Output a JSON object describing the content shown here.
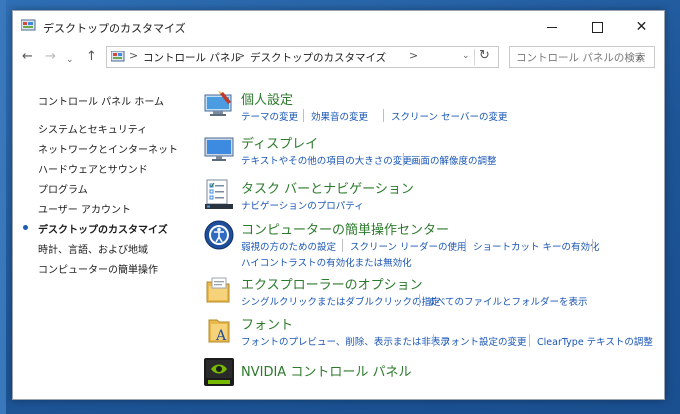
{
  "window": {
    "title": "デスクトップのカスタマイズ",
    "controls": {
      "minimize": "",
      "maximize": "",
      "close": "✕"
    }
  },
  "nav": {
    "back": "←",
    "forward": "→",
    "recent": "⌄",
    "up": "↑",
    "breadcrumbs": [
      "コントロール パネル",
      "デスクトップのカスタマイズ"
    ],
    "crumb_separator": ">",
    "refresh": "↻",
    "dropdown": "⌄"
  },
  "search": {
    "placeholder": "コントロール パネルの検索",
    "icon": "⌕"
  },
  "sidebar": {
    "home": "コントロール パネル ホーム",
    "items": [
      "システムとセキュリティ",
      "ネットワークとインターネット",
      "ハードウェアとサウンド",
      "プログラム",
      "ユーザー アカウント",
      "デスクトップのカスタマイズ",
      "時計、言語、および地域",
      "コンピューターの簡単操作"
    ],
    "current_index": 5
  },
  "categories": [
    {
      "title": "個人設定",
      "icon": "personalization-icon",
      "links": [
        "テーマの変更",
        "効果音の変更",
        "スクリーン セーバーの変更"
      ]
    },
    {
      "title": "ディスプレイ",
      "icon": "display-icon",
      "links": [
        "テキストやその他の項目の大きさの変更",
        "画面の解像度の調整"
      ]
    },
    {
      "title": "タスク バーとナビゲーション",
      "icon": "taskbar-icon",
      "links": [
        "ナビゲーションのプロパティ"
      ]
    },
    {
      "title": "コンピューターの簡単操作センター",
      "icon": "ease-of-access-icon",
      "links": [
        "弱視の方のための設定",
        "スクリーン リーダーの使用",
        "ショートカット キーの有効化"
      ],
      "links2": [
        "ハイコントラストの有効化または無効化"
      ]
    },
    {
      "title": "エクスプローラーのオプション",
      "icon": "folder-options-icon",
      "links": [
        "シングルクリックまたはダブルクリックの指定",
        "すべてのファイルとフォルダーを表示"
      ]
    },
    {
      "title": "フォント",
      "icon": "fonts-icon",
      "links": [
        "フォントのプレビュー、削除、表示または非表示",
        "フォント設定の変更",
        "ClearType テキストの調整"
      ]
    },
    {
      "title": "NVIDIA コントロール パネル",
      "icon": "nvidia-icon",
      "links": []
    }
  ],
  "colors": {
    "category_title": "#2c7a2c",
    "link": "#1a56b5",
    "desktop": "#1d5597"
  }
}
